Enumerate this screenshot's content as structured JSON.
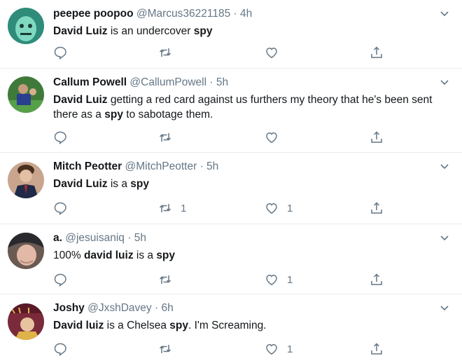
{
  "tweets": [
    {
      "name": "peepee poopoo",
      "handle": "@Marcus36221185",
      "time": "4h",
      "segments": [
        {
          "t": "David Luiz",
          "b": true
        },
        {
          "t": " is an undercover ",
          "b": false
        },
        {
          "t": "spy",
          "b": true
        }
      ],
      "retweets": "",
      "likes": "",
      "avatar": {
        "bg": "#2f8c7a",
        "fg": "#7fd8c0"
      }
    },
    {
      "name": "Callum Powell",
      "handle": "@CallumPowell",
      "time": "5h",
      "segments": [
        {
          "t": "David Luiz",
          "b": true
        },
        {
          "t": " getting a red card against us furthers my theory that he's been sent there as a ",
          "b": false
        },
        {
          "t": "spy",
          "b": true
        },
        {
          "t": " to sabotage them.",
          "b": false
        }
      ],
      "retweets": "",
      "likes": "",
      "avatar": {
        "bg": "#3f7a3a",
        "fg": "#2a3f8f"
      }
    },
    {
      "name": "Mitch Peotter",
      "handle": "@MitchPeotter",
      "time": "5h",
      "segments": [
        {
          "t": "David Luiz",
          "b": true
        },
        {
          "t": " is a ",
          "b": false
        },
        {
          "t": "spy",
          "b": true
        }
      ],
      "retweets": "1",
      "likes": "1",
      "avatar": {
        "bg": "#c9a58e",
        "fg": "#1f2a48"
      }
    },
    {
      "name": "a.",
      "handle": "@jesuisaniq",
      "time": "5h",
      "segments": [
        {
          "t": "100% ",
          "b": false
        },
        {
          "t": "david luiz",
          "b": true
        },
        {
          "t": " is a ",
          "b": false
        },
        {
          "t": "spy",
          "b": true
        }
      ],
      "retweets": "",
      "likes": "1",
      "avatar": {
        "bg": "#6b5a52",
        "fg": "#e2b9a6"
      }
    },
    {
      "name": "Joshy",
      "handle": "@JxshDavey",
      "time": "6h",
      "segments": [
        {
          "t": "David luiz",
          "b": true
        },
        {
          "t": " is a Chelsea ",
          "b": false
        },
        {
          "t": "spy",
          "b": true
        },
        {
          "t": ". I'm Screaming.",
          "b": false
        }
      ],
      "retweets": "",
      "likes": "1",
      "avatar": {
        "bg": "#7a2a3a",
        "fg": "#e0b24a"
      }
    }
  ],
  "colors": {
    "text": "#14171a",
    "muted": "#657786",
    "divider": "#e6ecf0"
  }
}
